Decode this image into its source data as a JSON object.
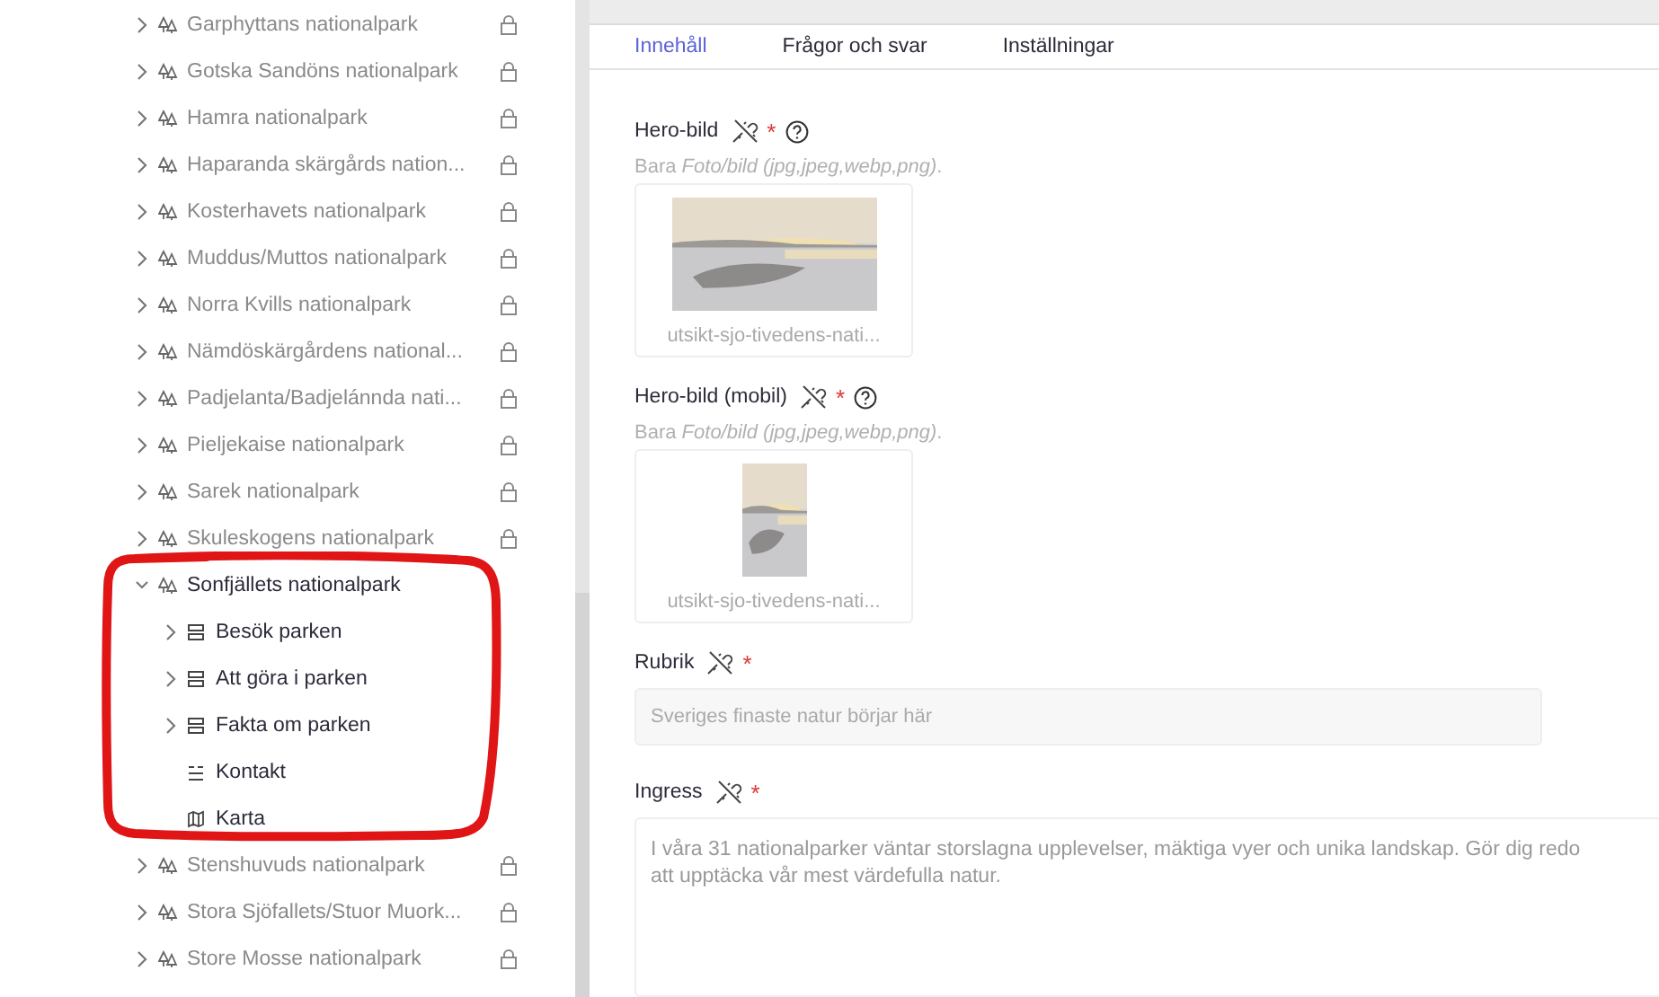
{
  "tree": [
    {
      "name": "Garphyttans nationalpark",
      "kind": "park",
      "expanded": false,
      "locked": true
    },
    {
      "name": "Gotska Sandöns nationalpark",
      "kind": "park",
      "expanded": false,
      "locked": true
    },
    {
      "name": "Hamra nationalpark",
      "kind": "park",
      "expanded": false,
      "locked": true
    },
    {
      "name": "Haparanda skärgårds nation...",
      "kind": "park",
      "expanded": false,
      "locked": true
    },
    {
      "name": "Kosterhavets nationalpark",
      "kind": "park",
      "expanded": false,
      "locked": true
    },
    {
      "name": "Muddus/Muttos nationalpark",
      "kind": "park",
      "expanded": false,
      "locked": true
    },
    {
      "name": "Norra Kvills nationalpark",
      "kind": "park",
      "expanded": false,
      "locked": true
    },
    {
      "name": "Nämdöskärgårdens national...",
      "kind": "park",
      "expanded": false,
      "locked": true
    },
    {
      "name": "Padjelanta/Badjelánnda nati...",
      "kind": "park",
      "expanded": false,
      "locked": true
    },
    {
      "name": "Pieljekaise nationalpark",
      "kind": "park",
      "expanded": false,
      "locked": true
    },
    {
      "name": "Sarek nationalpark",
      "kind": "park",
      "expanded": false,
      "locked": true
    },
    {
      "name": "Skuleskogens nationalpark",
      "kind": "park",
      "expanded": false,
      "locked": true
    },
    {
      "name": "Sonfjällets nationalpark",
      "kind": "park",
      "expanded": true,
      "locked": false,
      "children": [
        {
          "name": "Besök parken",
          "kind": "section",
          "expanded": false
        },
        {
          "name": "Att göra i parken",
          "kind": "section",
          "expanded": false
        },
        {
          "name": "Fakta om parken",
          "kind": "section",
          "expanded": false
        },
        {
          "name": "Kontakt",
          "kind": "text"
        },
        {
          "name": "Karta",
          "kind": "map"
        }
      ]
    },
    {
      "name": "Stenshuvuds nationalpark",
      "kind": "park",
      "expanded": false,
      "locked": true
    },
    {
      "name": "Stora Sjöfallets/Stuor Muork...",
      "kind": "park",
      "expanded": false,
      "locked": true
    },
    {
      "name": "Store Mosse nationalpark",
      "kind": "park",
      "expanded": false,
      "locked": true
    }
  ],
  "tabs": [
    {
      "label": "Innehåll",
      "selected": true
    },
    {
      "label": "Frågor och svar",
      "selected": false
    },
    {
      "label": "Inställningar",
      "selected": false
    }
  ],
  "fields": [
    {
      "label": "Hero-bild",
      "required_mark": "*",
      "help": true,
      "hint": "Bara *Foto/bild (jpg,jpeg,webp,png)*.",
      "filename": "utsikt-sjo-tivedens-nati..."
    },
    {
      "kind": "mobile_image",
      "label": "Hero-bild (mobil)",
      "required_mark": "*",
      "help": true,
      "hint": "Bara *Foto/bild (jpg,jpeg,webp,png)*.",
      "filename": "utsikt-sjo-tivedens-nati..."
    },
    {
      "kind": "text",
      "label": "Rubrik",
      "required_mark": "*",
      "help": false,
      "value": "Sveriges finaste natur börjar här"
    },
    {
      "kind": "textarea",
      "label": "Ingress",
      "required_mark": "*",
      "help": false,
      "value": "I våra 31 nationalparker väntar storslagna upplevelser, mäktiga vyer och unika landskap. Gör dig redo att upptäcka vår mest värdefulla natur."
    }
  ],
  "annotation": {
    "kind": "circle"
  }
}
